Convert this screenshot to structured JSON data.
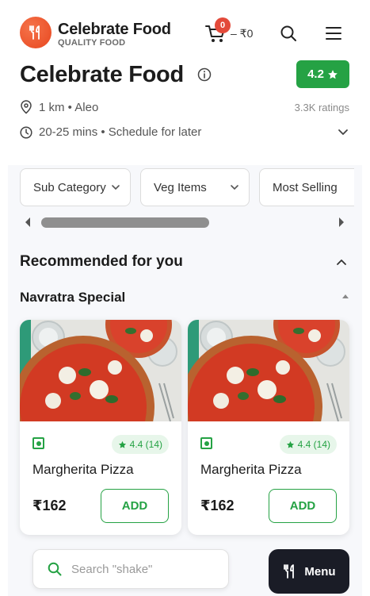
{
  "header": {
    "brand_name": "Celebrate Food",
    "brand_tagline": "QUALITY FOOD",
    "cart_count": "0",
    "cart_total": "– ₹0"
  },
  "restaurant": {
    "name": "Celebrate Food",
    "rating": "4.2",
    "location": "1 km • Aleo",
    "ratings_count": "3.3K ratings",
    "delivery_time": "20-25 mins • Schedule for later"
  },
  "filters": [
    {
      "label": "Sub Category"
    },
    {
      "label": "Veg Items"
    },
    {
      "label": "Most Selling"
    }
  ],
  "section": {
    "title": "Recommended for you",
    "subsection": "Navratra Special"
  },
  "items": [
    {
      "name": "Margherita Pizza",
      "price": "₹162",
      "rating": "4.4 (14)",
      "add_label": "ADD"
    },
    {
      "name": "Margherita Pizza",
      "price": "₹162",
      "rating": "4.4 (14)",
      "add_label": "ADD"
    }
  ],
  "bottom": {
    "search_placeholder": "Search \"shake\"",
    "menu_label": "Menu"
  },
  "colors": {
    "accent_green": "#25a244",
    "brand_orange": "#e8471f",
    "dark_fab": "#1a1c26"
  }
}
